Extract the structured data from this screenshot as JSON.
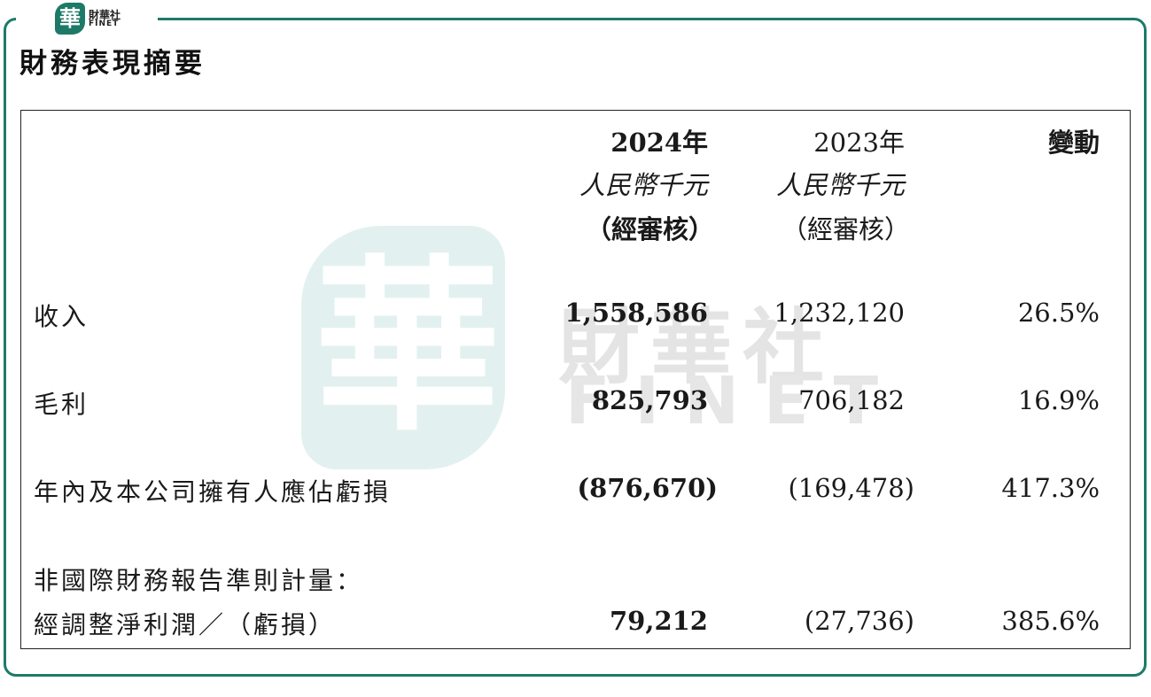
{
  "brand": {
    "seal_char": "華",
    "name_cn": "財華社",
    "name_en": "FINET"
  },
  "title": "財務表現摘要",
  "watermark": {
    "seal_char": "華",
    "cn": "財華社",
    "en": "FINET"
  },
  "columns": {
    "col2024": {
      "year": "2024年",
      "unit": "人民幣千元",
      "note": "（經審核）"
    },
    "col2023": {
      "year": "2023年",
      "unit": "人民幣千元",
      "note": "（經審核）"
    },
    "change": {
      "label": "變動"
    }
  },
  "rows": [
    {
      "label": "收入",
      "v2024": "1,558,586",
      "v2023": "1,232,120",
      "change": "26.5%"
    },
    {
      "label": "毛利",
      "v2024": "825,793",
      "v2023": "706,182",
      "change": "16.9%"
    },
    {
      "label": "年內及本公司擁有人應佔虧損",
      "v2024": "(876,670)",
      "v2023": "(169,478)",
      "change": "417.3%"
    },
    {
      "label_line1": "非國際財務報告準則計量：",
      "label": "經調整淨利潤／（虧損）",
      "v2024": "79,212",
      "v2023": "(27,736)",
      "change": "385.6%"
    }
  ],
  "colors": {
    "frame": "#1e7a68",
    "watermark_seal": "#d8ecea"
  }
}
